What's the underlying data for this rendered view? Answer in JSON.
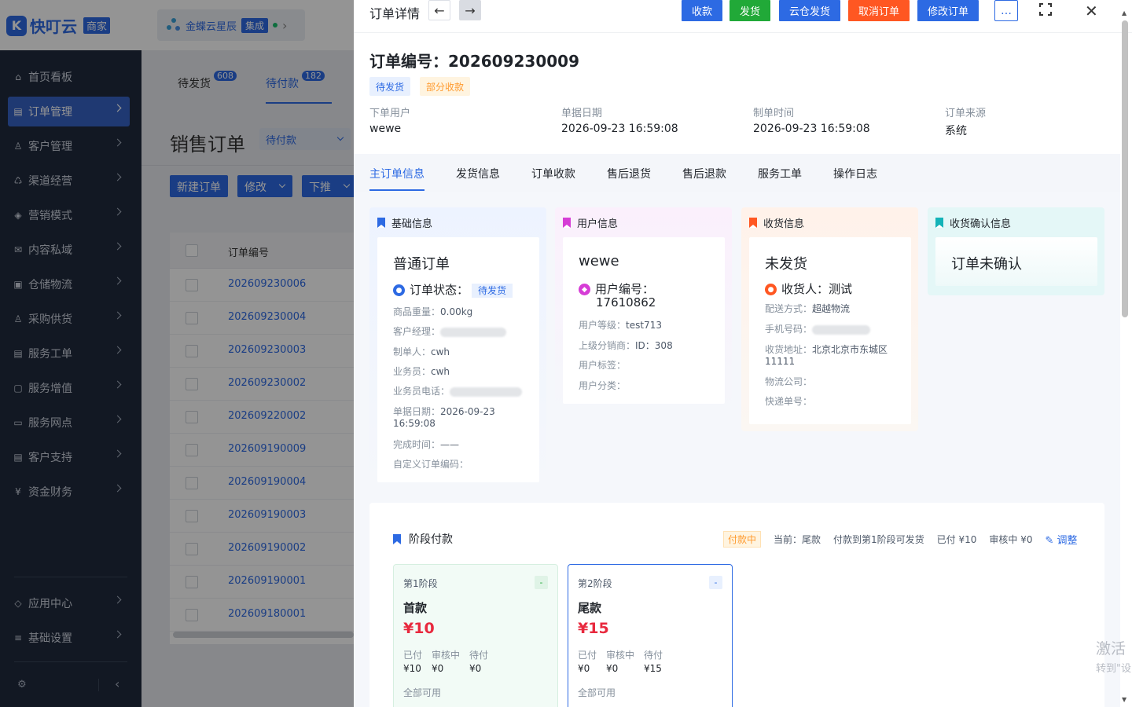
{
  "brand": {
    "logo_mark": "K",
    "name": "快叮云",
    "tag": "商家"
  },
  "tenant": {
    "name": "金蝶云星辰",
    "badge": "集成",
    "chevron": "›"
  },
  "sidebar": {
    "items": [
      {
        "label": "首页看板",
        "icon": "home-icon"
      },
      {
        "label": "订单管理",
        "icon": "order-icon",
        "active": true
      },
      {
        "label": "客户管理",
        "icon": "user-icon"
      },
      {
        "label": "渠道经营",
        "icon": "channel-icon"
      },
      {
        "label": "营销模式",
        "icon": "tag-icon"
      },
      {
        "label": "内容私域",
        "icon": "mail-icon"
      },
      {
        "label": "仓储物流",
        "icon": "warehouse-icon"
      },
      {
        "label": "采购供货",
        "icon": "purchase-icon"
      },
      {
        "label": "服务工单",
        "icon": "ticket-icon"
      },
      {
        "label": "服务增值",
        "icon": "bag-icon"
      },
      {
        "label": "服务网点",
        "icon": "store-icon"
      },
      {
        "label": "客户支持",
        "icon": "support-icon"
      },
      {
        "label": "资金财务",
        "icon": "yen-icon"
      }
    ],
    "bottom_items": [
      {
        "label": "应用中心",
        "icon": "cube-icon"
      },
      {
        "label": "基础设置",
        "icon": "settings-list-icon"
      }
    ],
    "collapse_glyph": "‹"
  },
  "list": {
    "tabs": [
      {
        "label": "待发货",
        "count": "608"
      },
      {
        "label": "待付款",
        "count": "182"
      }
    ],
    "title": "销售订单",
    "status_filter": "待付款",
    "toolbar": {
      "new": "新建订单",
      "edit": "修改",
      "push": "下推"
    },
    "column_order_no": "订单编号",
    "orders": [
      "202609230006",
      "202609230004",
      "202609230003",
      "202609230002",
      "202609220002",
      "202609190009",
      "202609190004",
      "202609190003",
      "202609190002",
      "202609190001",
      "202609180001"
    ]
  },
  "drawer": {
    "title": "订单详情",
    "prev_glyph": "←",
    "next_glyph": "→",
    "actions": [
      {
        "label": "收款",
        "color": "#2d6ae3"
      },
      {
        "label": "发货",
        "color": "#21a938"
      },
      {
        "label": "云仓发货",
        "color": "#2d6ae3"
      },
      {
        "label": "取消订单",
        "color": "#ff5722"
      },
      {
        "label": "修改订单",
        "color": "#2d6ae3"
      }
    ],
    "more": "…",
    "close": "✕",
    "order_title": "订单编号：202609230009",
    "tags": {
      "status": "待发货",
      "payment": "部分收款"
    },
    "meta": [
      {
        "label": "下单用户",
        "value": "wewe"
      },
      {
        "label": "单据日期",
        "value": "2026-09-23 16:59:08"
      },
      {
        "label": "制单时间",
        "value": "2026-09-23 16:59:08"
      },
      {
        "label": "订单来源",
        "value": "系统"
      }
    ],
    "tabs": [
      "主订单信息",
      "发货信息",
      "订单收款",
      "售后退货",
      "售后退款",
      "服务工单",
      "操作日志"
    ],
    "basic": {
      "header": "基础信息",
      "type": "普通订单",
      "status_label": "订单状态：",
      "status_value": "待发货",
      "rows": [
        {
          "k": "商品重量：",
          "v": "0.00kg"
        },
        {
          "k": "客户经理：",
          "v": ""
        },
        {
          "k": "制单人：",
          "v": "cwh"
        },
        {
          "k": "业务员：",
          "v": "cwh"
        },
        {
          "k": "业务员电话：",
          "v": ""
        },
        {
          "k": "单据日期：",
          "v": "2026-09-23 16:59:08"
        },
        {
          "k": "完成时间：",
          "v": "——"
        },
        {
          "k": "自定义订单编码：",
          "v": ""
        }
      ]
    },
    "user": {
      "header": "用户信息",
      "name": "wewe",
      "id_label": "用户编号：",
      "id_value": "17610862",
      "rows": [
        {
          "k": "用户等级：",
          "v": "test713"
        },
        {
          "k": "上级分销商：",
          "v": "ID：308"
        },
        {
          "k": "用户标签：",
          "v": ""
        },
        {
          "k": "用户分类：",
          "v": ""
        }
      ]
    },
    "receive": {
      "header": "收货信息",
      "state": "未发货",
      "receiver_label": "收货人：",
      "receiver_value": "测试",
      "rows": [
        {
          "k": "配送方式：",
          "v": "超越物流"
        },
        {
          "k": "手机号码：",
          "v": ""
        },
        {
          "k": "收货地址：",
          "v": "北京北京市东城区11111"
        },
        {
          "k": "物流公司：",
          "v": ""
        },
        {
          "k": "快递单号：",
          "v": ""
        }
      ]
    },
    "confirm": {
      "header": "收货确认信息",
      "text": "订单未确认"
    },
    "payment": {
      "title": "阶段付款",
      "status_badge": "付款中",
      "current": "当前：尾款",
      "rule": "付款到第1阶段可发货",
      "paid": "已付 ¥10",
      "reviewing": "审核中 ¥0",
      "adjust": "调整",
      "stages": [
        {
          "stage": "第1阶段",
          "name": "首款",
          "amount": "¥10",
          "paid": "¥10",
          "reviewing": "¥0",
          "pending": "¥0",
          "status": "全部可用",
          "mini": "-"
        },
        {
          "stage": "第2阶段",
          "name": "尾款",
          "amount": "¥15",
          "paid": "¥0",
          "reviewing": "¥0",
          "pending": "¥15",
          "status": "全部可用",
          "mini": "-"
        }
      ],
      "labels": {
        "paid": "已付",
        "reviewing": "审核中",
        "pending": "待付"
      }
    }
  },
  "watermark": {
    "line1": "激活",
    "line2": "转到\"设"
  }
}
